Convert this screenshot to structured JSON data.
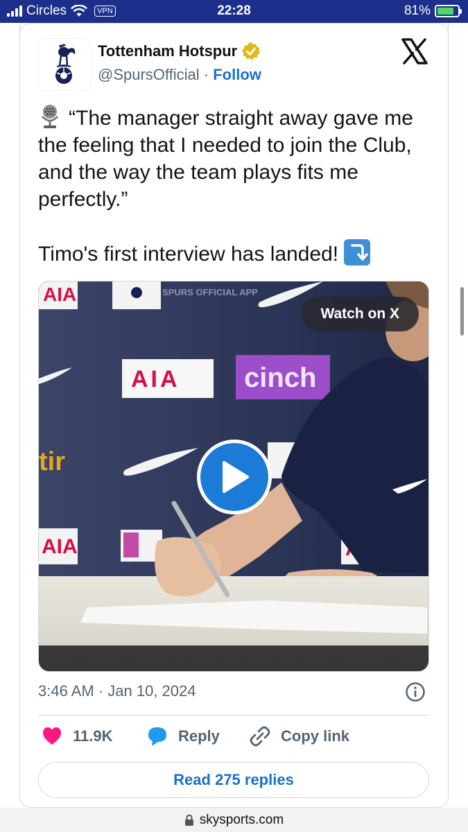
{
  "status_bar": {
    "carrier": "Circles",
    "vpn": "VPN",
    "time": "22:28",
    "battery": "81%",
    "battery_level": 0.81,
    "background_color": "#1c2f8a"
  },
  "tweet": {
    "display_name": "Tottenham Hotspur",
    "handle": "@SpursOfficial",
    "separator": "·",
    "follow_label": "Follow",
    "verified_badge": "gold-verified-icon",
    "text_line_1": "“The manager straight away gave me the feeling that I needed to join the Club, and the way the team plays fits me perfectly.”",
    "text_line_2": "Timo's first interview has landed!",
    "media": {
      "watch_label": "Watch on X",
      "play_icon": "play-icon",
      "board_text": [
        "AIA",
        "cinch",
        "AIA",
        "AIA",
        "tir",
        "SPURS OFFICIAL APP",
        "AIA"
      ]
    },
    "timestamp": "3:46 AM · Jan 10, 2024",
    "likes": "11.9K",
    "reply_label": "Reply",
    "copy_link_label": "Copy link",
    "read_replies_label": "Read 275 replies",
    "colors": {
      "link_blue": "#1a6fc9",
      "like_pink": "#f91880",
      "reply_blue": "#1d9bf0",
      "secondary_text": "#536471"
    }
  },
  "browser": {
    "url": "skysports.com",
    "lock_icon": "lock-icon"
  }
}
